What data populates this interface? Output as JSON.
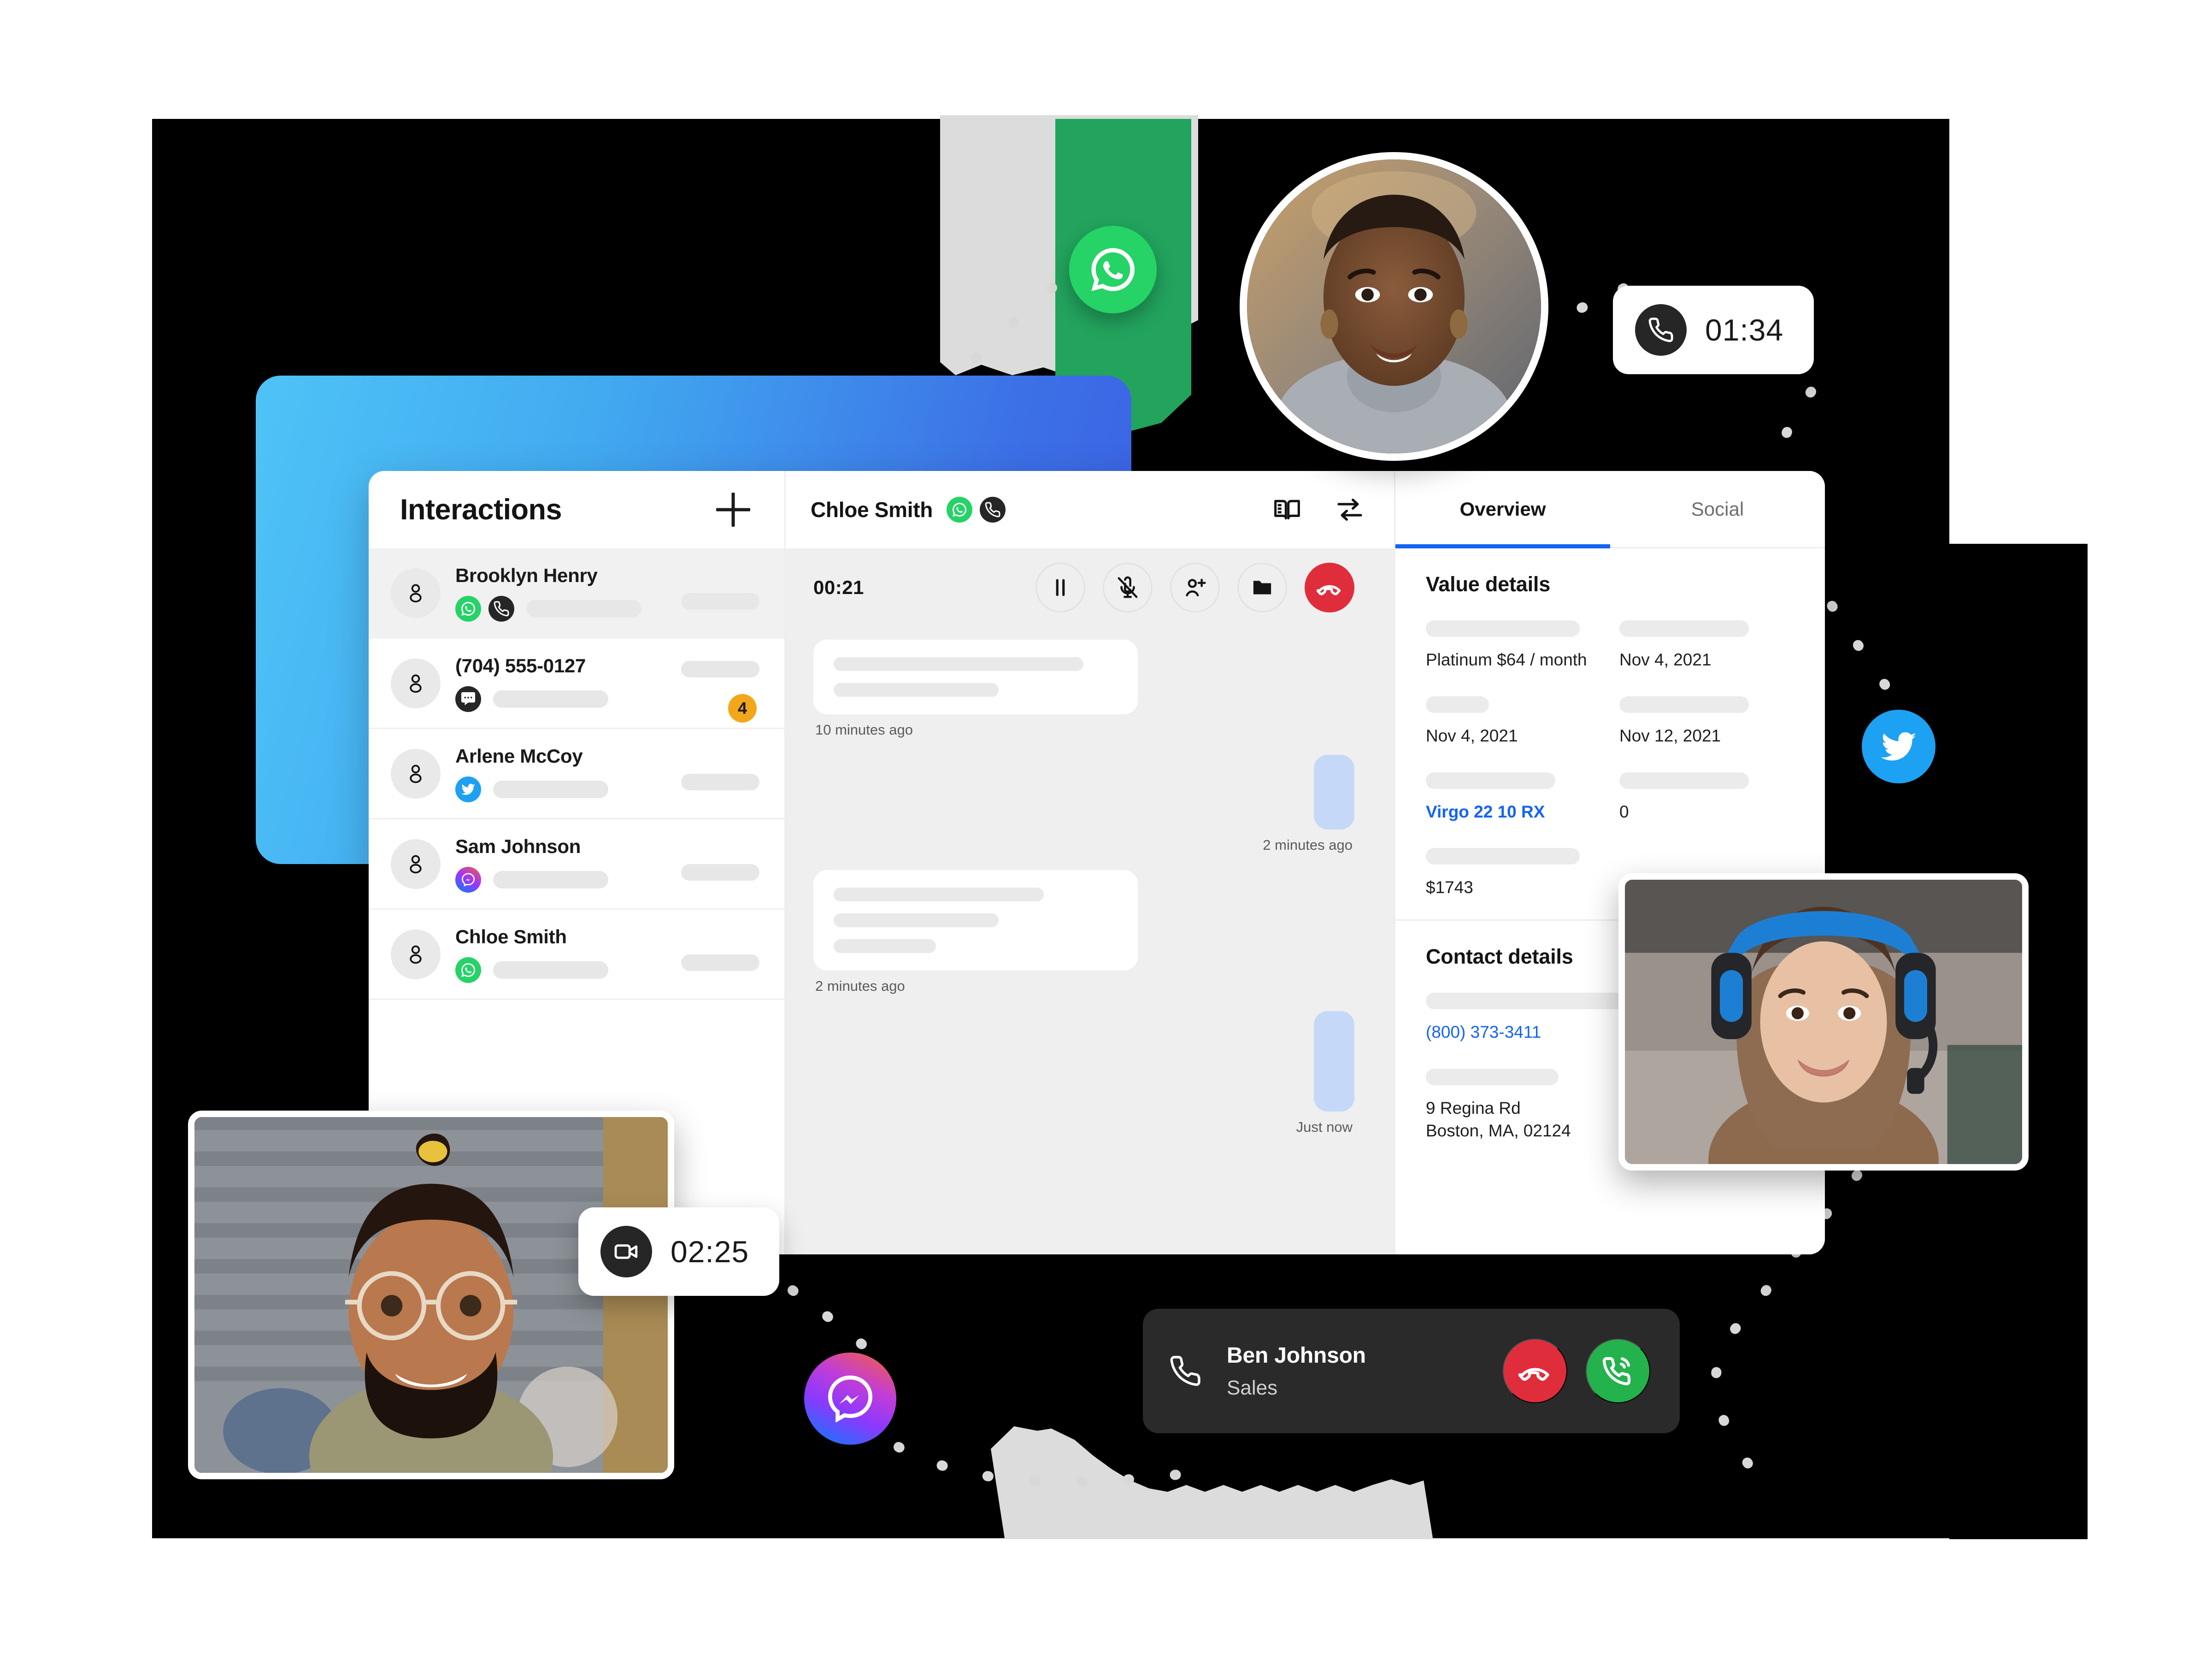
{
  "sidebar": {
    "title": "Interactions",
    "add_button_label": "+",
    "conversations": [
      {
        "name": "Brooklyn Henry",
        "channels": [
          "whatsapp",
          "phone"
        ],
        "active": true,
        "badge": ""
      },
      {
        "name": "(704) 555-0127",
        "channels": [
          "sms"
        ],
        "active": false,
        "badge": "4"
      },
      {
        "name": "Arlene McCoy",
        "channels": [
          "twitter"
        ],
        "active": false,
        "badge": ""
      },
      {
        "name": "Sam Johnson",
        "channels": [
          "messenger"
        ],
        "active": false,
        "badge": ""
      },
      {
        "name": "Chloe Smith",
        "channels": [
          "whatsapp"
        ],
        "active": false,
        "badge": ""
      }
    ]
  },
  "conversation": {
    "contact_name": "Chloe Smith",
    "channels": [
      "whatsapp",
      "phone"
    ],
    "tools": [
      "knowledge-base-icon",
      "transfer-icon"
    ],
    "call_timer": "00:21",
    "call_actions": [
      "pause-icon",
      "mute-icon",
      "add-participant-icon",
      "folder-icon",
      "end-call-icon"
    ],
    "messages": [
      {
        "direction": "in",
        "lines": 2,
        "timestamp": "10 minutes ago"
      },
      {
        "direction": "out",
        "lines": 2,
        "timestamp": "2 minutes ago"
      },
      {
        "direction": "in",
        "lines": 3,
        "timestamp": "2 minutes ago"
      },
      {
        "direction": "out",
        "lines": 3,
        "timestamp": "Just now"
      }
    ]
  },
  "details": {
    "tabs": [
      {
        "label": "Overview",
        "active": true
      },
      {
        "label": "Social",
        "active": false
      }
    ],
    "value_details": {
      "title": "Value details",
      "fields": [
        {
          "value": "Platinum   $64 / month",
          "style": "plain"
        },
        {
          "value": "Nov 4, 2021",
          "style": "plain"
        },
        {
          "value": "Nov 4, 2021",
          "style": "plain"
        },
        {
          "value": "Nov 12, 2021",
          "style": "plain"
        },
        {
          "value": "Virgo 22 10 RX",
          "style": "link-bold"
        },
        {
          "value": "0",
          "style": "plain"
        },
        {
          "value": "$1743",
          "style": "plain"
        }
      ]
    },
    "contact_details": {
      "title": "Contact details",
      "phone": "(800) 373-3411",
      "address_line1": "9 Regina Rd",
      "address_line2": "Boston, MA, 02124"
    }
  },
  "floating": {
    "call_pill": {
      "icon": "phone-icon",
      "time": "01:34"
    },
    "video_pill": {
      "icon": "video-icon",
      "time": "02:25"
    },
    "bubbles": [
      "whatsapp-icon",
      "twitter-icon",
      "messenger-icon"
    ]
  },
  "incoming_call": {
    "icon": "phone-icon",
    "name": "Ben Johnson",
    "role": "Sales",
    "decline_label": "decline-call",
    "accept_label": "accept-call"
  },
  "colors": {
    "accent_blue": "#1463F3",
    "whatsapp_green": "#25D366",
    "twitter_blue": "#1DA1F2",
    "danger_red": "#E02D3C",
    "accept_green": "#23B24B",
    "badge_amber": "#F2A71B"
  }
}
